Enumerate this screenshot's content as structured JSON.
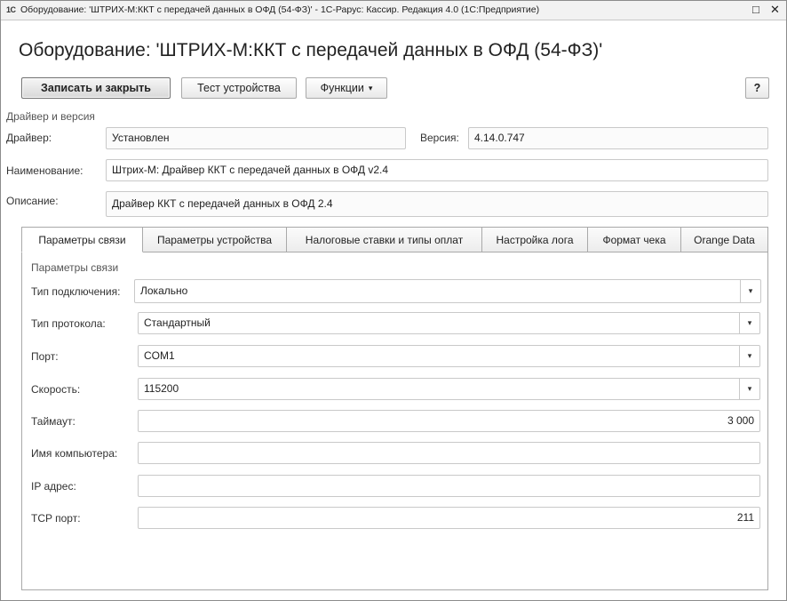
{
  "window": {
    "app_logo": "1С",
    "title": "Оборудование: 'ШТРИХ-М:ККТ с передачей данных в ОФД (54-ФЗ)' - 1С-Рарус: Кассир. Редакция 4.0  (1С:Предприятие)",
    "maximize_glyph": "□",
    "close_glyph": "✕"
  },
  "heading": "Оборудование: 'ШТРИХ-М:ККТ с передачей данных в ОФД (54-ФЗ)'",
  "toolbar": {
    "save_close": "Записать и закрыть",
    "test_device": "Тест устройства",
    "functions": "Функции",
    "functions_arrow": "▾",
    "help": "?"
  },
  "driver": {
    "section_title": "Драйвер и версия",
    "driver_label": "Драйвер:",
    "driver_value": "Установлен",
    "version_label": "Версия:",
    "version_value": "4.14.0.747",
    "name_label": "Наименование:",
    "name_value": "Штрих-М: Драйвер ККТ с передачей данных в ОФД v2.4",
    "desc_label": "Описание:",
    "desc_value": "Драйвер ККТ с передачей данных в ОФД 2.4"
  },
  "tabs": [
    {
      "label": "Параметры связи"
    },
    {
      "label": "Параметры устройства"
    },
    {
      "label": "Налоговые ставки и типы оплат"
    },
    {
      "label": "Настройка лога"
    },
    {
      "label": "Формат чека"
    },
    {
      "label": "Orange Data"
    }
  ],
  "connection": {
    "section_title": "Параметры связи",
    "arrow": "▾",
    "fields": {
      "conn_type": {
        "label": "Тип подключения:",
        "value": "Локально"
      },
      "protocol": {
        "label": "Тип протокола:",
        "value": "Стандартный"
      },
      "port": {
        "label": "Порт:",
        "value": "COM1"
      },
      "speed": {
        "label": "Скорость:",
        "value": "115200"
      },
      "timeout": {
        "label": "Таймаут:",
        "value": "3 000"
      },
      "computer": {
        "label": "Имя компьютера:",
        "value": ""
      },
      "ip": {
        "label": "IP адрес:",
        "value": ""
      },
      "tcp_port": {
        "label": "TCP порт:",
        "value": "211"
      }
    }
  }
}
